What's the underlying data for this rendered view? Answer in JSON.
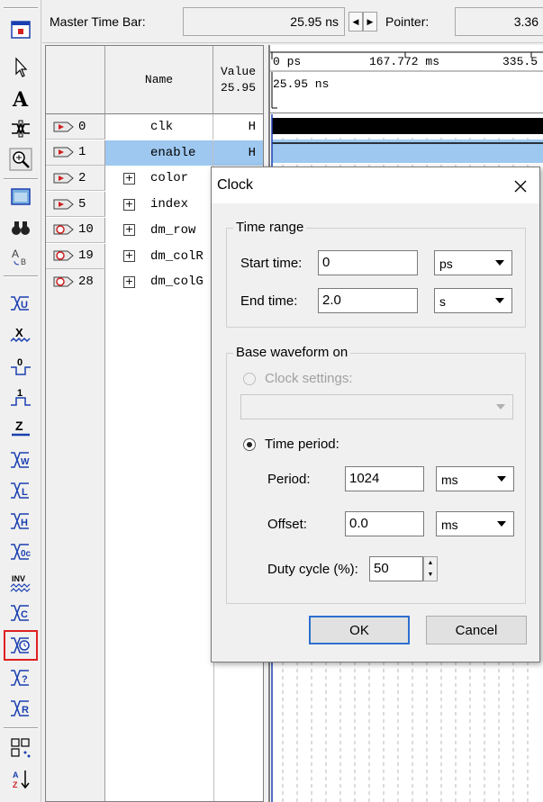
{
  "topbar": {
    "master_label": "Master Time Bar:",
    "master_value": "25.95 ns",
    "pointer_label": "Pointer:",
    "pointer_value": "3.36"
  },
  "table": {
    "name_header": "Name",
    "value_header_line1": "Value",
    "value_header_line2": "25.95",
    "rows": [
      {
        "id": "0",
        "name": "clk",
        "value": "H",
        "expand": false,
        "selected": false,
        "icon": "input-pin-icon"
      },
      {
        "id": "1",
        "name": "enable",
        "value": "H",
        "expand": false,
        "selected": true,
        "icon": "input-pin-icon"
      },
      {
        "id": "2",
        "name": "color",
        "value": "",
        "expand": true,
        "selected": false,
        "icon": "input-pin-icon"
      },
      {
        "id": "5",
        "name": "index",
        "value": "",
        "expand": true,
        "selected": false,
        "icon": "input-pin-icon"
      },
      {
        "id": "10",
        "name": "dm_row",
        "value": "",
        "expand": true,
        "selected": false,
        "icon": "output-pin-icon"
      },
      {
        "id": "19",
        "name": "dm_colR",
        "value": "",
        "expand": true,
        "selected": false,
        "icon": "output-pin-icon"
      },
      {
        "id": "28",
        "name": "dm_colG",
        "value": "",
        "expand": true,
        "selected": false,
        "icon": "output-pin-icon"
      }
    ]
  },
  "waveform": {
    "tick_0": "0 ps",
    "tick_1": "167.772 ms",
    "tick_2": "335.5",
    "cursor_label": "25.95 ns"
  },
  "dialog": {
    "title": "Clock",
    "time_range": {
      "title": "Time range",
      "start_label": "Start time:",
      "start_value": "0",
      "start_unit": "ps",
      "end_label": "End time:",
      "end_value": "2.0",
      "end_unit": "s"
    },
    "base": {
      "title": "Base waveform on",
      "clock_settings_label": "Clock settings:",
      "clock_settings_value": "",
      "time_period_label": "Time period:",
      "period_label": "Period:",
      "period_value": "1024",
      "period_unit": "ms",
      "offset_label": "Offset:",
      "offset_value": "0.0",
      "offset_unit": "ms",
      "duty_label": "Duty cycle (%):",
      "duty_value": "50"
    },
    "ok_label": "OK",
    "cancel_label": "Cancel"
  },
  "colors": {
    "selection": "#9ec8f0",
    "highlight_box": "#e02020",
    "icon_blue": "#1a3fb0"
  }
}
